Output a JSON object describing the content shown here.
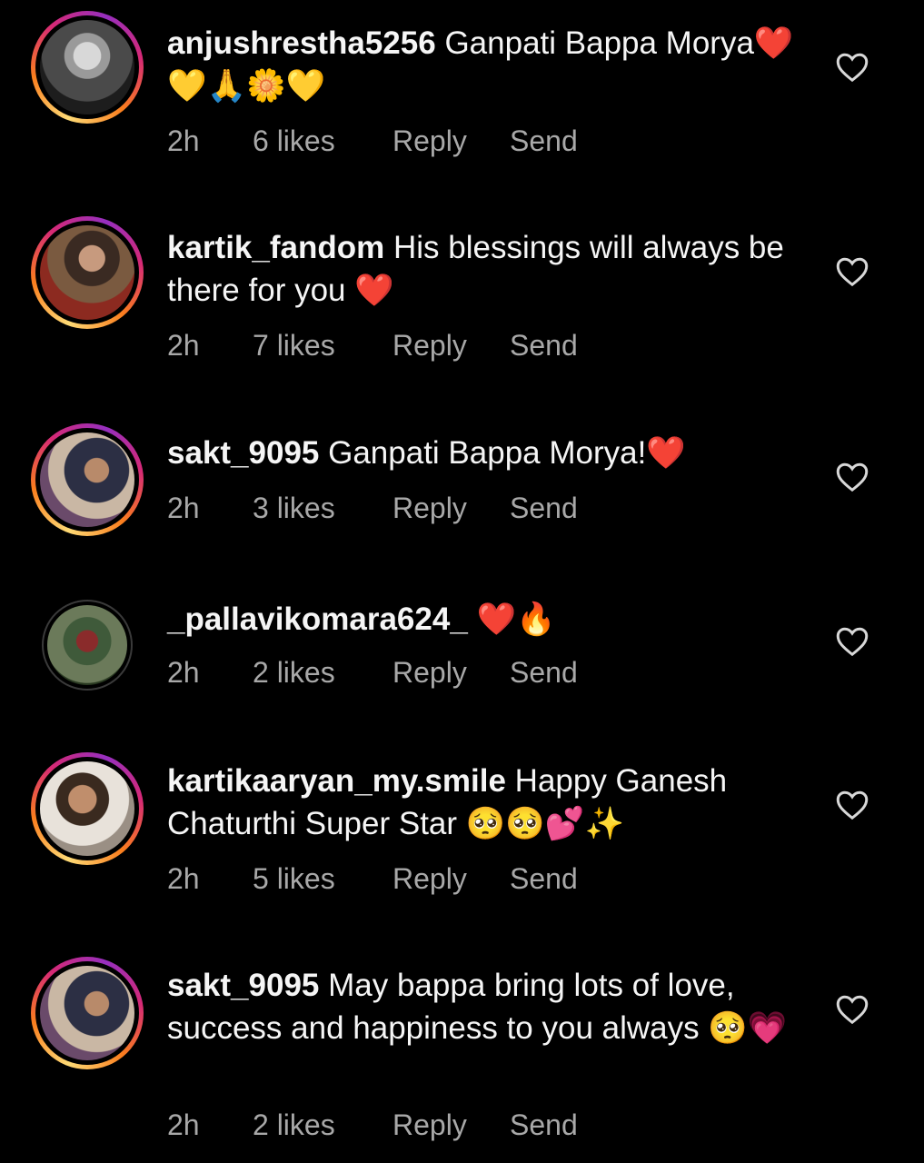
{
  "colors": {
    "background": "#000000",
    "text": "#f5f5f5",
    "meta_text": "#a8a8a8",
    "story_ring": [
      "#feda75",
      "#fa7e1e",
      "#d62976",
      "#962fbf"
    ]
  },
  "comments": [
    {
      "username": "anjushrestha5256",
      "text": " Ganpati Bappa Morya❤️💛🙏🌼💛",
      "time": "2h",
      "likes": "6 likes",
      "reply": "Reply",
      "send": "Send",
      "avatar_style": "story",
      "like_icon": "heart-outline-icon"
    },
    {
      "username": "kartik_fandom",
      "text": " His blessings will always be there for you ❤️",
      "time": "2h",
      "likes": "7 likes",
      "reply": "Reply",
      "send": "Send",
      "avatar_style": "story",
      "like_icon": "heart-outline-icon"
    },
    {
      "username": "sakt_9095",
      "text": " Ganpati Bappa Morya!❤️",
      "time": "2h",
      "likes": "3 likes",
      "reply": "Reply",
      "send": "Send",
      "avatar_style": "story",
      "like_icon": "heart-outline-icon"
    },
    {
      "username": "_pallavikomara624_",
      "text": " ❤️🔥",
      "time": "2h",
      "likes": "2 likes",
      "reply": "Reply",
      "send": "Send",
      "avatar_style": "plain",
      "like_icon": "heart-outline-icon"
    },
    {
      "username": "kartikaaryan_my.smile",
      "text": " Happy Ganesh Chaturthi Super Star 🥺🥺💕✨",
      "time": "2h",
      "likes": "5 likes",
      "reply": "Reply",
      "send": "Send",
      "avatar_style": "story",
      "like_icon": "heart-outline-icon"
    },
    {
      "username": "sakt_9095",
      "text": " May bappa bring lots of love, success and happiness to you always 🥺💗",
      "time": "2h",
      "likes": "2 likes",
      "reply": "Reply",
      "send": "Send",
      "avatar_style": "story",
      "like_icon": "heart-outline-icon"
    }
  ]
}
